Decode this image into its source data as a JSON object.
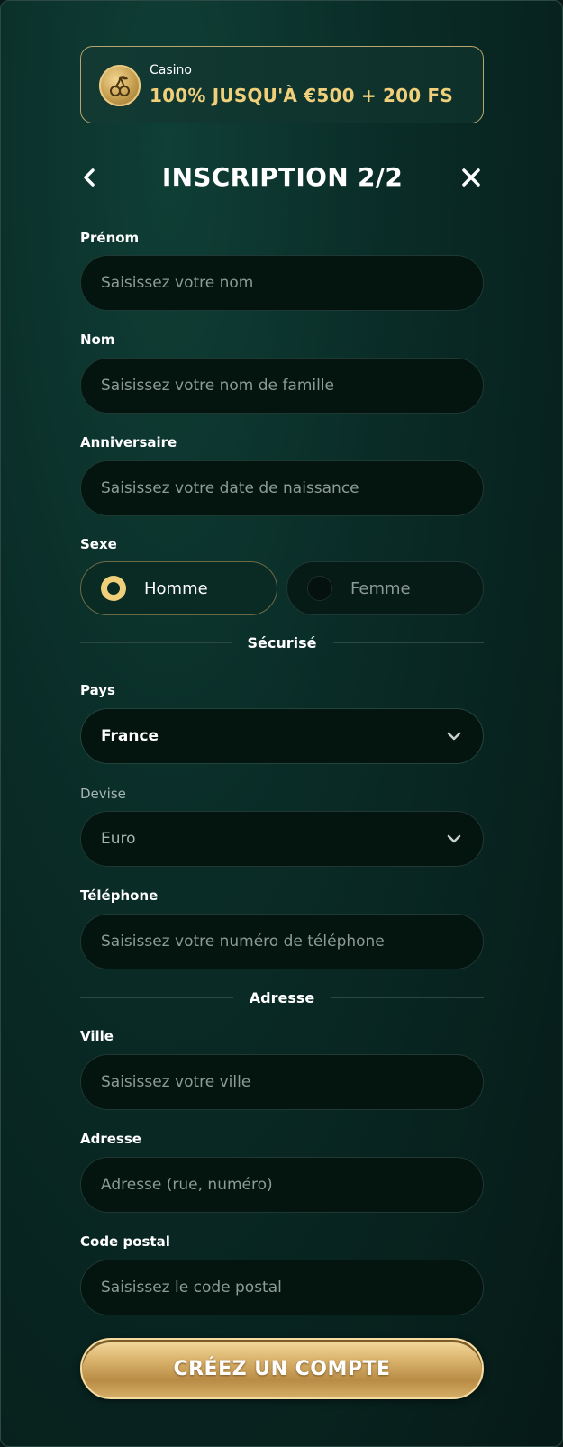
{
  "promo": {
    "category": "Casino",
    "offer": "100% JUSQU'À €500 + 200 FS"
  },
  "header": {
    "title": "INSCRIPTION 2/2"
  },
  "fields": {
    "first_name": {
      "label": "Prénom",
      "placeholder": "Saisissez votre nom"
    },
    "last_name": {
      "label": "Nom",
      "placeholder": "Saisissez votre nom de famille"
    },
    "birthday": {
      "label": "Anniversaire",
      "placeholder": "Saisissez votre date de naissance"
    },
    "gender": {
      "label": "Sexe",
      "options": [
        "Homme",
        "Femme"
      ],
      "selected": "Homme"
    },
    "country": {
      "label": "Pays",
      "value": "France"
    },
    "currency": {
      "label": "Devise",
      "value": "Euro"
    },
    "phone": {
      "label": "Téléphone",
      "placeholder": "Saisissez votre numéro de téléphone"
    },
    "city": {
      "label": "Ville",
      "placeholder": "Saisissez votre ville"
    },
    "address": {
      "label": "Adresse",
      "placeholder": "Adresse (rue, numéro)"
    },
    "postal_code": {
      "label": "Code postal",
      "placeholder": "Saisissez le code postal"
    }
  },
  "dividers": {
    "secure": "Sécurisé",
    "address": "Adresse"
  },
  "submit": {
    "label": "CRÉEZ UN COMPTE"
  },
  "colors": {
    "accent_gold": "#f0cf7a",
    "background": "#0a2c27",
    "input_bg": "#04140f"
  }
}
